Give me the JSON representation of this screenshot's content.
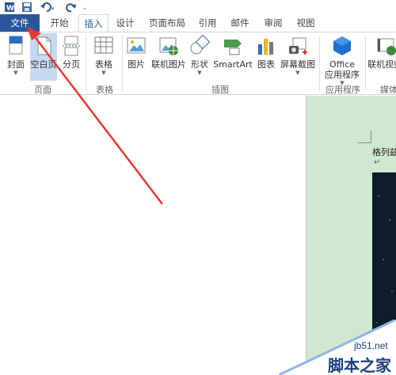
{
  "quick_access": {
    "word_icon": "word-app-icon",
    "save_icon": "save-icon",
    "undo_icon": "undo-icon",
    "redo_icon": "redo-icon",
    "customize_icon": "customize-qat-icon"
  },
  "tabs": [
    {
      "label": "文件"
    },
    {
      "label": "开始"
    },
    {
      "label": "插入"
    },
    {
      "label": "设计"
    },
    {
      "label": "页面布局"
    },
    {
      "label": "引用"
    },
    {
      "label": "邮件"
    },
    {
      "label": "审阅"
    },
    {
      "label": "视图"
    }
  ],
  "ribbon": {
    "pages": {
      "cover": "封面",
      "blank": "空白页",
      "break": "分页",
      "group": "页面"
    },
    "tables": {
      "table": "表格",
      "group": "表格"
    },
    "illustrations": {
      "pictures": "图片",
      "online_pictures": "联机图片",
      "shapes": "形状",
      "smartart": "SmartArt",
      "chart": "图表",
      "screenshot": "屏幕截图",
      "group": "插图"
    },
    "apps": {
      "office_line1": "Office",
      "office_line2": "应用程序",
      "group": "应用程序"
    },
    "media": {
      "online_video": "联机视频",
      "group": "媒体"
    }
  },
  "document": {
    "text": "格列兹",
    "para_mark": "↵"
  },
  "watermark": {
    "url": "jb51.net",
    "name": "脚本之家"
  },
  "colors": {
    "file_tab": "#2b579a",
    "page_bg": "#cfe8cf",
    "arrow": "#e53935"
  }
}
